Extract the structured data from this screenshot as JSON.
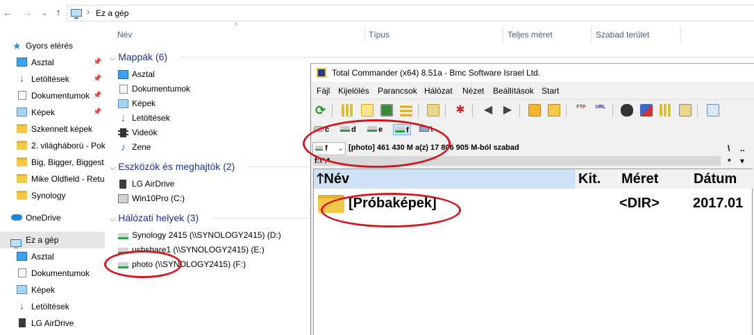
{
  "explorer": {
    "address": "Ez a gép",
    "nav": {
      "back": "←",
      "forward": "→",
      "dropdown": "⌄",
      "up": "↑"
    },
    "columns": {
      "name": "Név",
      "type": "Típus",
      "total": "Teljes méret",
      "free": "Szabad terület"
    },
    "sidebar": {
      "quick_access": "Gyors elérés",
      "quick_items": [
        "Asztal",
        "Letöltések",
        "Dokumentumok",
        "Képek",
        "Szkennelt képek",
        "2. világháború - Pok",
        "Big, Bigger, Biggest",
        "Mike Oldfield - Retu",
        "Synology"
      ],
      "onedrive": "OneDrive",
      "this_pc": "Ez a gép",
      "pc_items": [
        "Asztal",
        "Dokumentumok",
        "Képek",
        "Letöltések",
        "LG AirDrive"
      ]
    },
    "groups": {
      "folders": {
        "title": "Mappák (6)",
        "items": [
          "Asztal",
          "Dokumentumok",
          "Képek",
          "Letöltések",
          "Videók",
          "Zene"
        ]
      },
      "devices": {
        "title": "Eszközök és meghajtók (2)",
        "items": [
          "LG AirDrive",
          "Win10Pro (C:)"
        ]
      },
      "network": {
        "title": "Hálózati helyek (3)",
        "items": [
          "Synology 2415 (\\\\SYNOLOGY2415) (D:)",
          "usbshare1 (\\\\SYNOLOGY2415) (E:)",
          "photo (\\\\SYNOLOGY2415) (F:)"
        ]
      }
    }
  },
  "tc": {
    "title": "Total Commander (x64) 8.51a - Bmc Software Israel Ltd.",
    "menu": [
      "Fájl",
      "Kijelölés",
      "Parancsok",
      "Hálózat",
      "Nézet",
      "Beállítások",
      "Start"
    ],
    "drives": [
      "c",
      "d",
      "e",
      "f",
      "\\"
    ],
    "drive_select": "f",
    "path_info": "[photo]  461 430 M a(z) 17 806 905 M-ból szabad",
    "path_right": [
      "\\",
      ".."
    ],
    "tab_path": "f:\\*.*",
    "tab_right": [
      "*",
      "▾"
    ],
    "columns": {
      "name": "Név",
      "ext": "Kit.",
      "size": "Méret",
      "date": "Dátum"
    },
    "rows": [
      {
        "name": "[Próbaképek]",
        "size": "<DIR>",
        "date": "2017.01"
      }
    ]
  },
  "colors": {
    "annotation": "#d7151d",
    "selection": "#e5e5e5",
    "header": "#cfe1f5"
  }
}
